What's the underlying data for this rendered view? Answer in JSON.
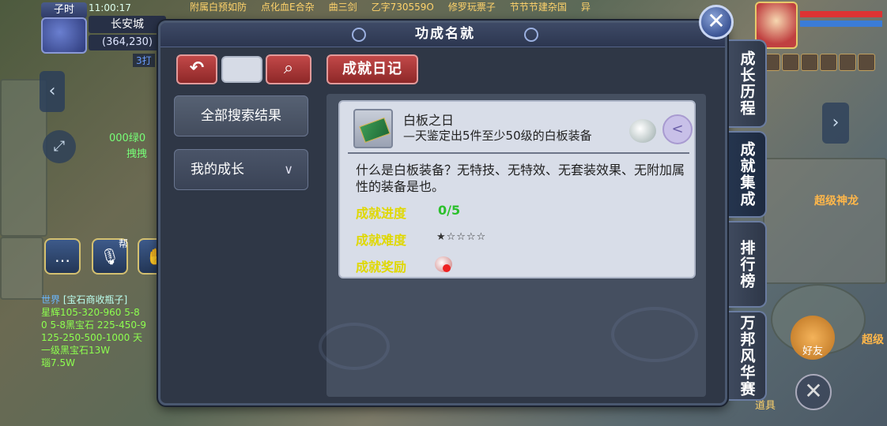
{
  "hud": {
    "time_label": "子时",
    "clock": "11:00:17",
    "city": "长安城",
    "coords": "(364,230)",
    "party": "3打",
    "npc_green": "000绿0",
    "npc_green2": "拽拽"
  },
  "top_banner": [
    "附属白预如防",
    "点化血E合杂",
    "曲三剑",
    "乙字730559O",
    "修罗玩票子",
    "节节节建杂国",
    "异"
  ],
  "world_chat": {
    "tag": "世界",
    "line1": "[宝石商收瓶子]",
    "line2": "星辉105-320-960 5-8",
    "line3": "0 5-8黑宝石 225-450-9",
    "line4": "125-250-500-1000 天",
    "line5": "一级黑宝石13W",
    "line6": "瑙7.5W"
  },
  "help_label": "帮",
  "dialog": {
    "title": "功成名就",
    "back_icon": "↶",
    "search_icon": "🔍",
    "diary_label": "成就日记",
    "nav_all": "全部搜索结果",
    "nav_growth": "我的成长",
    "nav_chevron": "∨",
    "close_icon": "✕"
  },
  "card": {
    "title": "白板之日",
    "subtitle": "—天鉴定出5件至少50级的白板装备",
    "share_icon": "<",
    "description": "什么是白板装备？无特技、无特效、无套装效果、无附加属性的装备是也。",
    "progress_label": "成就进度",
    "progress_value": "0/5",
    "difficulty_label": "成就难度",
    "difficulty_stars": "★☆☆☆☆",
    "reward_label": "成就奖励"
  },
  "tabs": {
    "growth": "成长历程",
    "collection": "成就集成",
    "ranking": "排行榜",
    "contest": "万邦风华赛"
  },
  "right_hud": {
    "dragon": "超级神龙",
    "dragon2": "超级",
    "friend": "好友",
    "close": "✕",
    "props": "道具"
  }
}
